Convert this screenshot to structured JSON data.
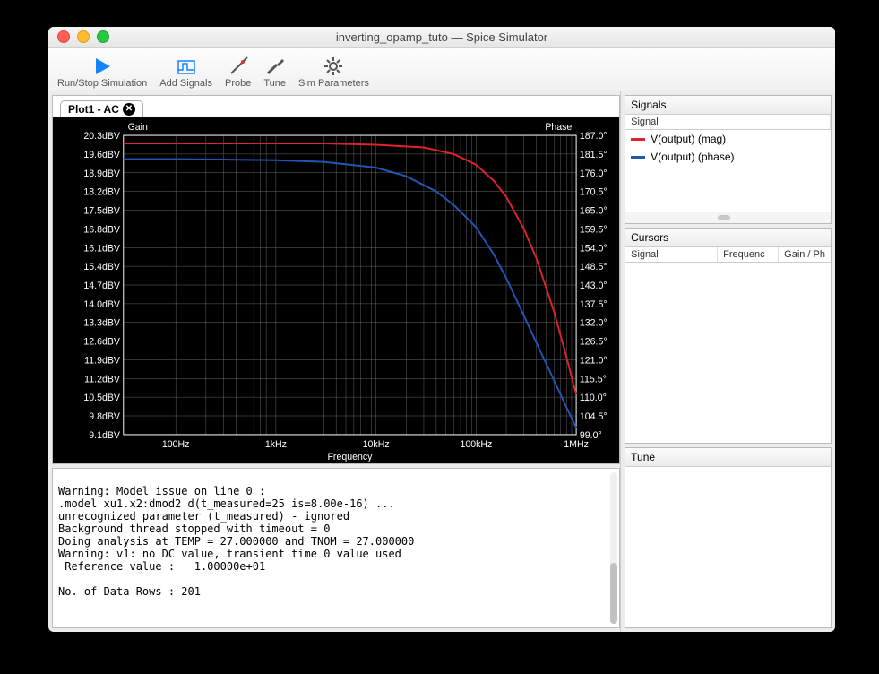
{
  "window": {
    "title": "inverting_opamp_tuto — Spice Simulator"
  },
  "toolbar": {
    "run_stop": "Run/Stop Simulation",
    "add_signals": "Add Signals",
    "probe": "Probe",
    "tune": "Tune",
    "sim_parameters": "Sim Parameters"
  },
  "plot": {
    "tab_label": "Plot1 - AC",
    "left_label": "Gain",
    "right_label": "Phase",
    "x_label": "Frequency"
  },
  "side": {
    "signals": {
      "title": "Signals",
      "header": "Signal",
      "items": [
        {
          "color": "#e22128",
          "label": "V(output) (mag)"
        },
        {
          "color": "#2156b5",
          "label": "V(output) (phase)"
        }
      ]
    },
    "cursors": {
      "title": "Cursors",
      "cols": [
        "Signal",
        "Frequenc",
        "Gain / Ph"
      ]
    },
    "tune": {
      "title": "Tune"
    }
  },
  "console": {
    "text": "Warning: Model issue on line 0 :\n.model xu1.x2:dmod2 d(t_measured=25 is=8.00e-16) ...\nunrecognized parameter (t_measured) - ignored\nBackground thread stopped with timeout = 0\nDoing analysis at TEMP = 27.000000 and TNOM = 27.000000\nWarning: v1: no DC value, transient time 0 value used\n Reference value :   1.00000e+01\n\nNo. of Data Rows : 201"
  },
  "chart_data": {
    "type": "line",
    "xscale": "log",
    "xlabel": "Frequency",
    "x_ticks": [
      "100Hz",
      "1kHz",
      "10kHz",
      "100kHz",
      "1MHz"
    ],
    "x_tick_values": [
      100,
      1000,
      10000,
      100000,
      1000000
    ],
    "x_range": [
      30,
      1000000
    ],
    "y_left": {
      "label": "Gain",
      "unit": "dBV",
      "ticks": [
        9.1,
        9.8,
        10.5,
        11.2,
        11.9,
        12.6,
        13.3,
        14.0,
        14.7,
        15.4,
        16.1,
        16.8,
        17.5,
        18.2,
        18.9,
        19.6,
        20.3
      ],
      "range": [
        9.1,
        20.3
      ]
    },
    "y_right": {
      "label": "Phase",
      "unit": "°",
      "ticks": [
        99.0,
        104.5,
        110.0,
        115.5,
        121.0,
        126.5,
        132.0,
        137.5,
        143.0,
        148.5,
        154.0,
        159.5,
        165.0,
        170.5,
        176.0,
        181.5,
        187.0
      ],
      "range": [
        99.0,
        187.0
      ]
    },
    "series": [
      {
        "name": "V(output) (mag)",
        "color": "#e22128",
        "axis": "left",
        "x": [
          30,
          100,
          300,
          1000,
          3000,
          10000,
          30000,
          60000,
          100000,
          150000,
          200000,
          300000,
          400000,
          600000,
          800000,
          1000000
        ],
        "values": [
          20.0,
          20.0,
          20.0,
          20.0,
          20.0,
          19.95,
          19.85,
          19.6,
          19.2,
          18.6,
          18.0,
          16.8,
          15.7,
          13.7,
          12.0,
          10.6
        ]
      },
      {
        "name": "V(output) (phase)",
        "color": "#2156b5",
        "axis": "right",
        "x": [
          30,
          100,
          300,
          1000,
          3000,
          10000,
          20000,
          40000,
          60000,
          100000,
          150000,
          200000,
          300000,
          400000,
          600000,
          800000,
          1000000
        ],
        "values": [
          180,
          180,
          179.9,
          179.7,
          179.2,
          177.5,
          175,
          170.5,
          166.5,
          160,
          152,
          145,
          134,
          126,
          115,
          107,
          101
        ]
      }
    ]
  }
}
